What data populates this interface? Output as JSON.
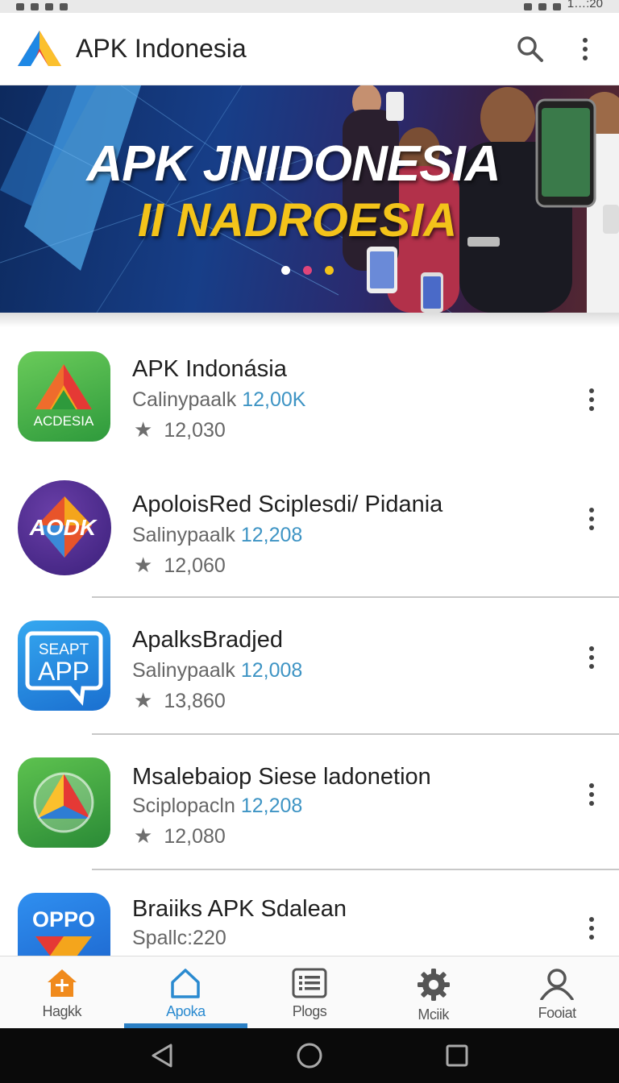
{
  "app": {
    "title": "APK Indonesia"
  },
  "status_bar": {
    "time": "1…:20"
  },
  "banner": {
    "line1": "APK JNIDONESIA",
    "line2": "II NADROESIA",
    "dot_colors": [
      "#ffffff",
      "#e0457a",
      "#f3c31a"
    ]
  },
  "apps": [
    {
      "title": "APK Indonásia",
      "sub_prefix": "Calinypaalk",
      "sub_count": "12,00K",
      "rating": "12,030",
      "icon_text": "ACDESIA",
      "icon": "triangle-logo-icon"
    },
    {
      "title": "ApoloisRed Sciplesdi/ Pidania",
      "sub_prefix": "Salinypaalk",
      "sub_count": "12,208",
      "rating": "12,060",
      "icon_text": "AODK",
      "icon": "diamond-logo-icon"
    },
    {
      "title": "ApalksBradjed",
      "sub_prefix": "Salinypaalk",
      "sub_count": "12,008",
      "rating": "13,860",
      "icon_text": "SEAPT",
      "icon_text2": "APP",
      "icon": "chat-bubble-logo-icon"
    },
    {
      "title": "Msalebaiop Siese ladonetion",
      "sub_prefix": "Sciplopacln",
      "sub_count": "12,208",
      "rating": "12,080",
      "icon": "color-triangle-logo-icon"
    },
    {
      "title": "Braiiks APK Sdalean",
      "sub_prefix": "Spallc:220",
      "sub_count": "",
      "rating": "",
      "icon_text": "OPPO",
      "icon": "oppo-logo-icon"
    }
  ],
  "bottom_nav": [
    {
      "label": "Hagkk",
      "icon": "home-icon",
      "active": false
    },
    {
      "label": "Apoka",
      "icon": "home-outline-icon",
      "active": true
    },
    {
      "label": "Plogs",
      "icon": "list-icon",
      "active": false
    },
    {
      "label": "Mciik",
      "icon": "gear-icon",
      "active": false
    },
    {
      "label": "Fooiat",
      "icon": "person-icon",
      "active": false
    }
  ],
  "colors": {
    "accent": "#2a7fc4",
    "link_blue": "#3e94c4",
    "banner_yellow": "#f3c31a"
  }
}
